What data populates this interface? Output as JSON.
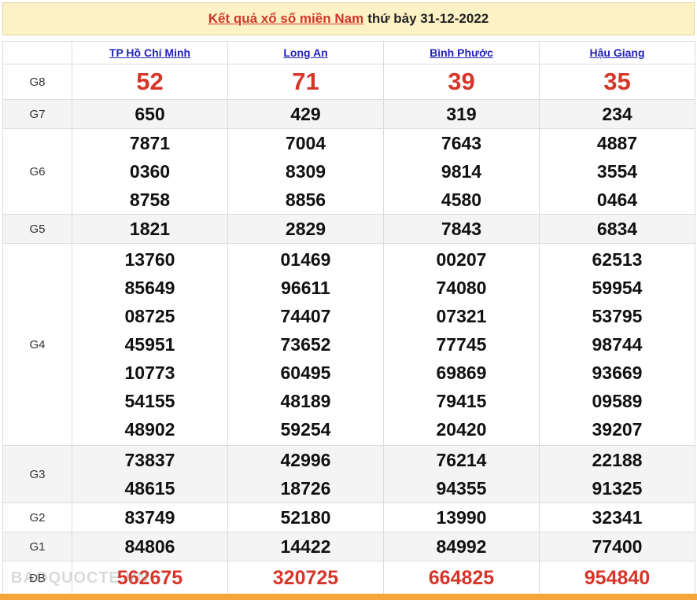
{
  "title": {
    "link_text": "Kết quả xổ số miền Nam",
    "rest": "thứ bảy 31-12-2022"
  },
  "provinces": [
    "TP Hồ Chí Minh",
    "Long An",
    "Bình Phước",
    "Hậu Giang"
  ],
  "prizes": [
    {
      "label": "G8",
      "values": [
        [
          "52"
        ],
        [
          "71"
        ],
        [
          "39"
        ],
        [
          "35"
        ]
      ]
    },
    {
      "label": "G7",
      "values": [
        [
          "650"
        ],
        [
          "429"
        ],
        [
          "319"
        ],
        [
          "234"
        ]
      ]
    },
    {
      "label": "G6",
      "values": [
        [
          "7871",
          "0360",
          "8758"
        ],
        [
          "7004",
          "8309",
          "8856"
        ],
        [
          "7643",
          "9814",
          "4580"
        ],
        [
          "4887",
          "3554",
          "0464"
        ]
      ]
    },
    {
      "label": "G5",
      "values": [
        [
          "1821"
        ],
        [
          "2829"
        ],
        [
          "7843"
        ],
        [
          "6834"
        ]
      ]
    },
    {
      "label": "G4",
      "values": [
        [
          "13760",
          "85649",
          "08725",
          "45951",
          "10773",
          "54155",
          "48902"
        ],
        [
          "01469",
          "96611",
          "74407",
          "73652",
          "60495",
          "48189",
          "59254"
        ],
        [
          "00207",
          "74080",
          "07321",
          "77745",
          "69869",
          "79415",
          "20420"
        ],
        [
          "62513",
          "59954",
          "53795",
          "98744",
          "93669",
          "09589",
          "39207"
        ]
      ]
    },
    {
      "label": "G3",
      "values": [
        [
          "73837",
          "48615"
        ],
        [
          "42996",
          "18726"
        ],
        [
          "76214",
          "94355"
        ],
        [
          "22188",
          "91325"
        ]
      ]
    },
    {
      "label": "G2",
      "values": [
        [
          "83749"
        ],
        [
          "52180"
        ],
        [
          "13990"
        ],
        [
          "32341"
        ]
      ]
    },
    {
      "label": "G1",
      "values": [
        [
          "84806"
        ],
        [
          "14422"
        ],
        [
          "84992"
        ],
        [
          "77400"
        ]
      ]
    },
    {
      "label": "ĐB",
      "values": [
        [
          "562675"
        ],
        [
          "320725"
        ],
        [
          "664825"
        ],
        [
          "954840"
        ]
      ]
    }
  ],
  "watermark": "BAOQUOCTE.VN",
  "colors": {
    "accent_red": "#d6352a",
    "link_blue": "#2222bb",
    "title_bg": "#fdf2c6",
    "bottom_bar": "#f5a53a"
  }
}
